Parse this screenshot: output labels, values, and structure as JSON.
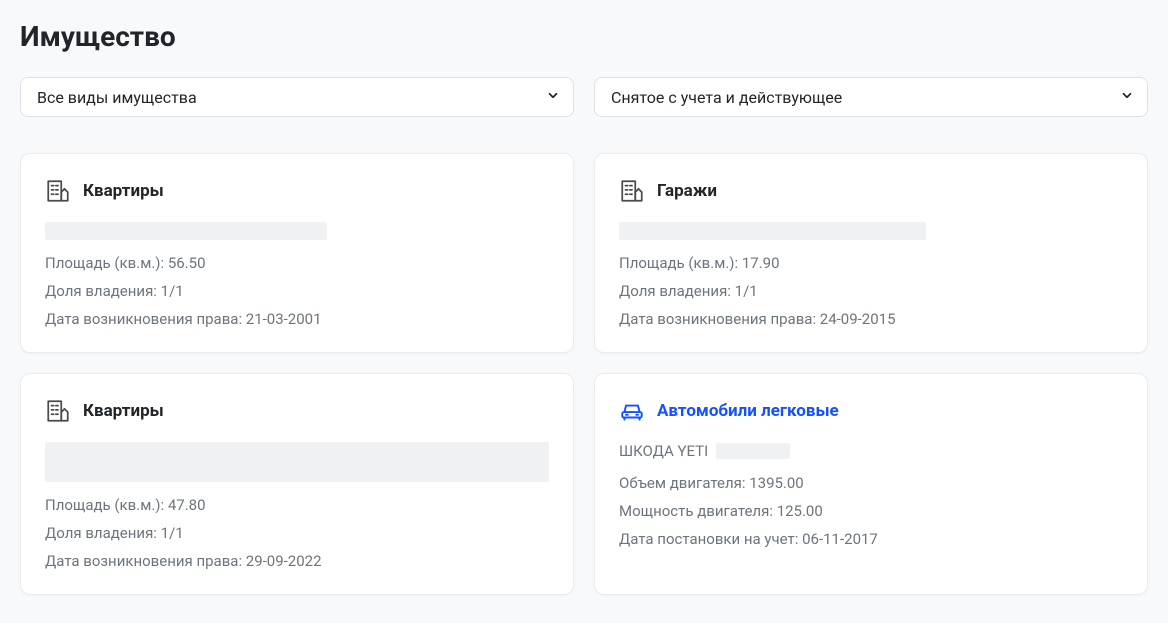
{
  "page": {
    "title": "Имущество"
  },
  "filters": {
    "type": {
      "selected": "Все виды имущества"
    },
    "status": {
      "selected": "Снятое с учета и действующее"
    }
  },
  "cards": [
    {
      "icon": "building",
      "title": "Квартиры",
      "title_is_link": false,
      "redacted_lines": 1,
      "sub_line": null,
      "props": [
        {
          "label": "Площадь (кв.м.)",
          "value": "56.50"
        },
        {
          "label": "Доля владения",
          "value": "1/1"
        },
        {
          "label": "Дата возникновения права",
          "value": "21-03-2001"
        }
      ]
    },
    {
      "icon": "building",
      "title": "Гаражи",
      "title_is_link": false,
      "redacted_lines": 1,
      "sub_line": null,
      "props": [
        {
          "label": "Площадь (кв.м.)",
          "value": "17.90"
        },
        {
          "label": "Доля владения",
          "value": "1/1"
        },
        {
          "label": "Дата возникновения права",
          "value": "24-09-2015"
        }
      ]
    },
    {
      "icon": "building",
      "title": "Квартиры",
      "title_is_link": false,
      "redacted_lines": 2,
      "sub_line": null,
      "props": [
        {
          "label": "Площадь (кв.м.)",
          "value": "47.80"
        },
        {
          "label": "Доля владения",
          "value": "1/1"
        },
        {
          "label": "Дата возникновения права",
          "value": "29-09-2022"
        }
      ]
    },
    {
      "icon": "car",
      "title": "Автомобили легковые",
      "title_is_link": true,
      "redacted_lines": 0,
      "sub_line": {
        "text": "ШКОДА YETI",
        "has_blur": true
      },
      "props": [
        {
          "label": "Объем двигателя",
          "value": "1395.00"
        },
        {
          "label": "Мощность двигателя",
          "value": "125.00"
        },
        {
          "label": "Дата постановки на учет",
          "value": "06-11-2017"
        }
      ]
    }
  ]
}
